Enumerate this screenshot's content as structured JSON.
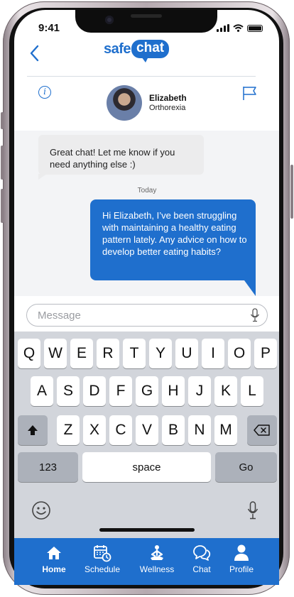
{
  "status_bar": {
    "time": "9:41"
  },
  "header": {
    "logo_safe": "safe",
    "logo_chat": "chat",
    "contact_name": "Elizabeth",
    "contact_subtitle": "Orthorexia"
  },
  "messages": {
    "incoming": "Great chat! Let me know if you need anything else :)",
    "day_label": "Today",
    "outgoing": "Hi Elizabeth, I’ve been struggling with maintaining a healthy eating pattern lately. Any advice on how to develop better eating habits?"
  },
  "composer": {
    "placeholder": "Message"
  },
  "keyboard": {
    "row1": [
      "Q",
      "W",
      "E",
      "R",
      "T",
      "Y",
      "U",
      "I",
      "O",
      "P"
    ],
    "row2": [
      "A",
      "S",
      "D",
      "F",
      "G",
      "H",
      "J",
      "K",
      "L"
    ],
    "row3": [
      "Z",
      "X",
      "C",
      "V",
      "B",
      "N",
      "M"
    ],
    "numbers_label": "123",
    "space_label": "space",
    "go_label": "Go"
  },
  "tabs": [
    {
      "label": "Home",
      "icon": "home-icon",
      "active": true
    },
    {
      "label": "Schedule",
      "icon": "calendar-clock-icon",
      "active": false
    },
    {
      "label": "Wellness",
      "icon": "meditation-icon",
      "active": false
    },
    {
      "label": "Chat",
      "icon": "chat-bubbles-icon",
      "active": false
    },
    {
      "label": "Profile",
      "icon": "person-icon",
      "active": false
    }
  ],
  "colors": {
    "brand": "#1f6fcd",
    "incoming_bubble": "#ececed",
    "keyboard_bg": "#d2d5db"
  }
}
